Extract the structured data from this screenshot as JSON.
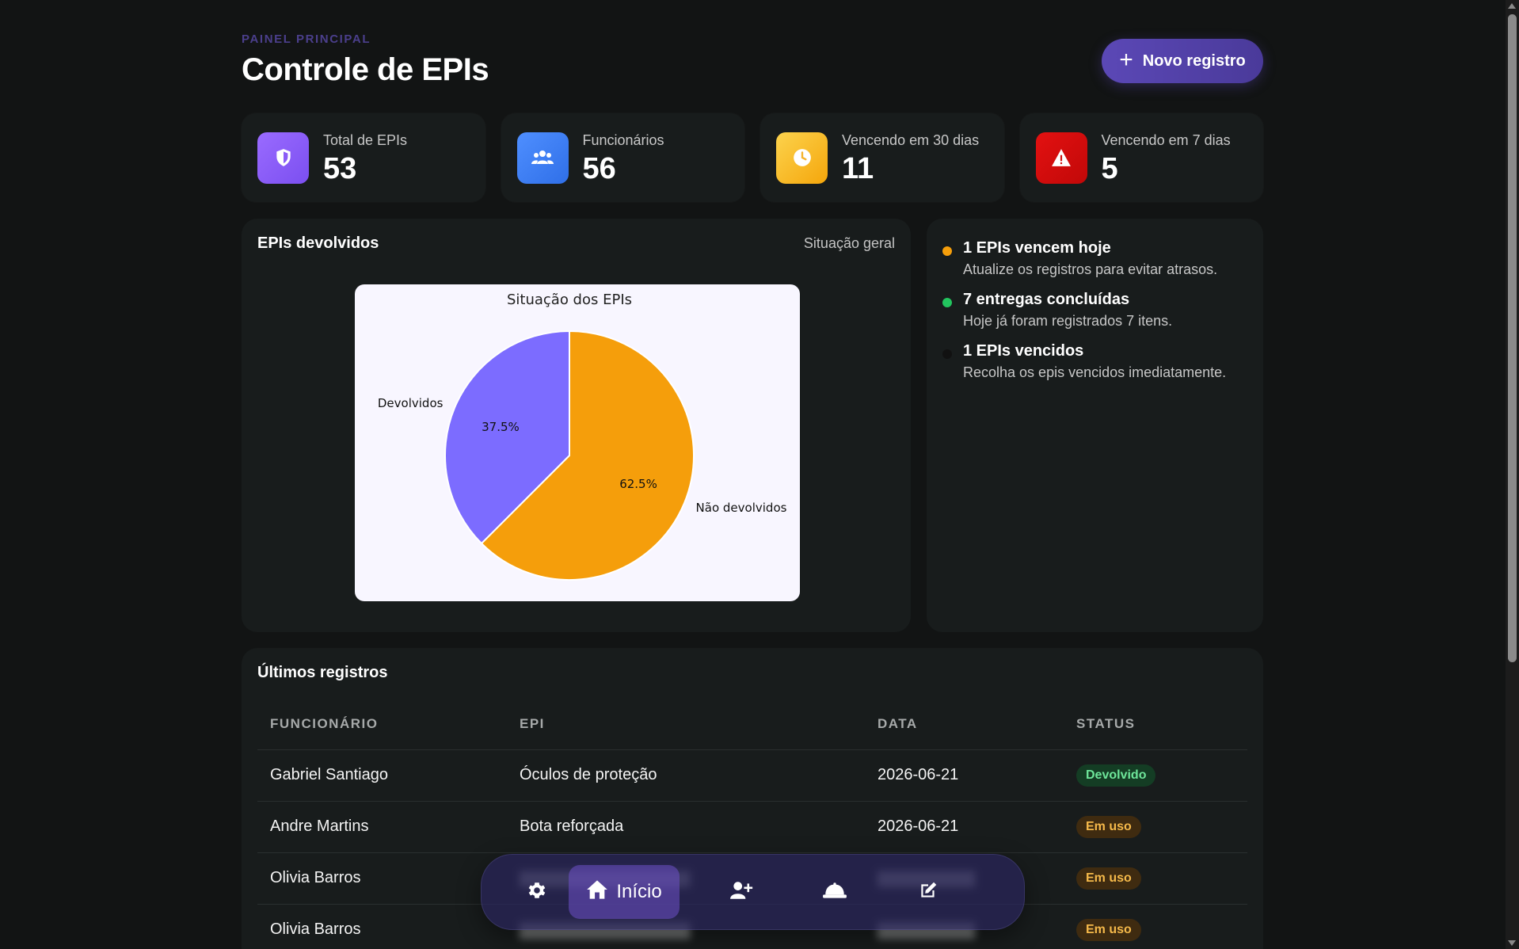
{
  "header": {
    "eyebrow": "PAINEL PRINCIPAL",
    "title": "Controle de EPIs",
    "new_button": "Novo registro"
  },
  "kpis": [
    {
      "label": "Total de EPIs",
      "value": "53",
      "icon": "shield-icon",
      "color": "#8b5cf6"
    },
    {
      "label": "Funcionários",
      "value": "56",
      "icon": "users-icon",
      "color": "#3b82f6"
    },
    {
      "label": "Vencendo em 30 dias",
      "value": "11",
      "icon": "clock-icon",
      "color": "#fbbf24"
    },
    {
      "label": "Vencendo em 7 dias",
      "value": "5",
      "icon": "warning-icon",
      "color": "#dc1010"
    }
  ],
  "chart_card": {
    "title": "EPIs devolvidos",
    "subtitle": "Situação geral"
  },
  "chart_data": {
    "type": "pie",
    "title": "Situação dos EPIs",
    "labels": [
      "Não devolvidos",
      "Devolvidos"
    ],
    "values": [
      62.5,
      37.5
    ],
    "value_labels": [
      "62.5%",
      "37.5%"
    ],
    "colors": [
      "#f59e0b",
      "#7c6cff"
    ]
  },
  "alerts": [
    {
      "title": "1 EPIs vencem hoje",
      "desc": "Atualize os registros para evitar atrasos.",
      "color": "#f59e0b"
    },
    {
      "title": "7 entregas concluídas",
      "desc": "Hoje já foram registrados 7 itens.",
      "color": "#22c55e"
    },
    {
      "title": "1 EPIs vencidos",
      "desc": "Recolha os epis vencidos imediatamente.",
      "color": "#111111"
    }
  ],
  "table": {
    "title": "Últimos registros",
    "columns": [
      "FUNCIONÁRIO",
      "EPI",
      "DATA",
      "STATUS"
    ],
    "rows": [
      {
        "funcionario": "Gabriel Santiago",
        "epi": "Óculos de proteção",
        "data": "2026-06-21",
        "status": "Devolvido"
      },
      {
        "funcionario": "Andre Martins",
        "epi": "Bota reforçada",
        "data": "2026-06-21",
        "status": "Em uso"
      },
      {
        "funcionario": "Olivia Barros",
        "epi": "",
        "data": "",
        "status": "Em uso"
      },
      {
        "funcionario": "Olivia Barros",
        "epi": "",
        "data": "",
        "status": "Em uso"
      }
    ]
  },
  "nav": {
    "active_label": "Início",
    "items": [
      "gear-icon",
      "home-icon",
      "user-plus-icon",
      "helmet-icon",
      "edit-icon"
    ]
  }
}
